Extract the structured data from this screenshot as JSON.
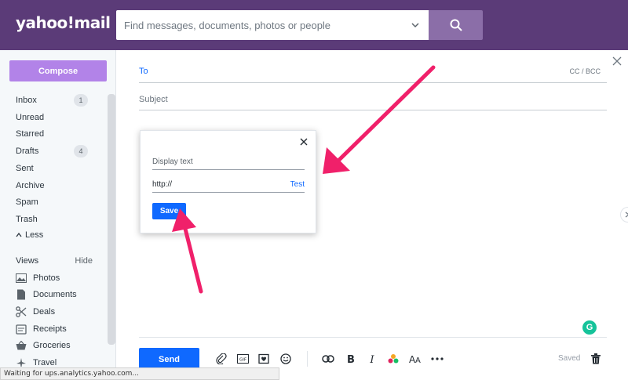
{
  "header": {
    "logo": "yahoo!mail",
    "search_placeholder": "Find messages, documents, photos or people"
  },
  "sidebar": {
    "compose_label": "Compose",
    "items": [
      {
        "label": "Inbox",
        "badge": "1"
      },
      {
        "label": "Unread",
        "badge": ""
      },
      {
        "label": "Starred",
        "badge": ""
      },
      {
        "label": "Drafts",
        "badge": "4"
      },
      {
        "label": "Sent",
        "badge": ""
      },
      {
        "label": "Archive",
        "badge": ""
      },
      {
        "label": "Spam",
        "badge": ""
      },
      {
        "label": "Trash",
        "badge": ""
      }
    ],
    "less_label": "Less",
    "views_label": "Views",
    "hide_label": "Hide",
    "views": [
      {
        "label": "Photos",
        "icon": "photo-icon"
      },
      {
        "label": "Documents",
        "icon": "document-icon"
      },
      {
        "label": "Deals",
        "icon": "scissors-icon"
      },
      {
        "label": "Receipts",
        "icon": "receipt-icon"
      },
      {
        "label": "Groceries",
        "icon": "basket-icon"
      },
      {
        "label": "Travel",
        "icon": "plane-icon"
      }
    ]
  },
  "compose": {
    "to_label": "To",
    "cc_bcc_label": "CC / BCC",
    "subject_label": "Subject",
    "send_label": "Send",
    "saved_label": "Saved"
  },
  "link_dialog": {
    "display_text_placeholder": "Display text",
    "url_value": "http://",
    "test_label": "Test",
    "save_label": "Save"
  },
  "status_bar": {
    "text": "Waiting for ups.analytics.yahoo.com..."
  },
  "colors": {
    "header_bg": "#5b3b78",
    "compose_button": "#b283e8",
    "primary_blue": "#0f69ff",
    "annotation_arrow": "#f0206a"
  }
}
